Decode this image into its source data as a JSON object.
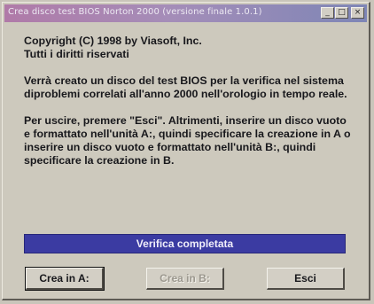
{
  "window": {
    "title": "Crea disco test BIOS Norton 2000 (versione finale 1.0.1)",
    "controls": {
      "minimize": "_",
      "maximize": "□",
      "close": "×"
    }
  },
  "body": {
    "copyright_line1": "Copyright (C) 1998 by Viasoft, Inc.",
    "copyright_line2": "Tutti i diritti riservati",
    "paragraph1": "Verrà creato un disco del test BIOS per la verifica nel sistema diproblemi correlati all'anno 2000 nell'orologio in tempo reale.",
    "paragraph2": "Per uscire, premere \"Esci\". Altrimenti, inserire un disco vuoto e formattato nell'unità A:, quindi specificare la creazione in A o inserire un disco vuoto e formattato nell'unità B:, quindi specificare la creazione in B."
  },
  "status": {
    "text": "Verifica completata"
  },
  "buttons": {
    "create_a": "Crea in A:",
    "create_b": "Crea in B:",
    "exit": "Esci"
  },
  "colors": {
    "title_gradient_start": "#b07aa8",
    "title_gradient_end": "#7e86b6",
    "status_bar": "#3b3ba2",
    "window_face": "#cdc9bd"
  },
  "icons": [
    "minimize-icon",
    "maximize-icon",
    "close-icon"
  ]
}
